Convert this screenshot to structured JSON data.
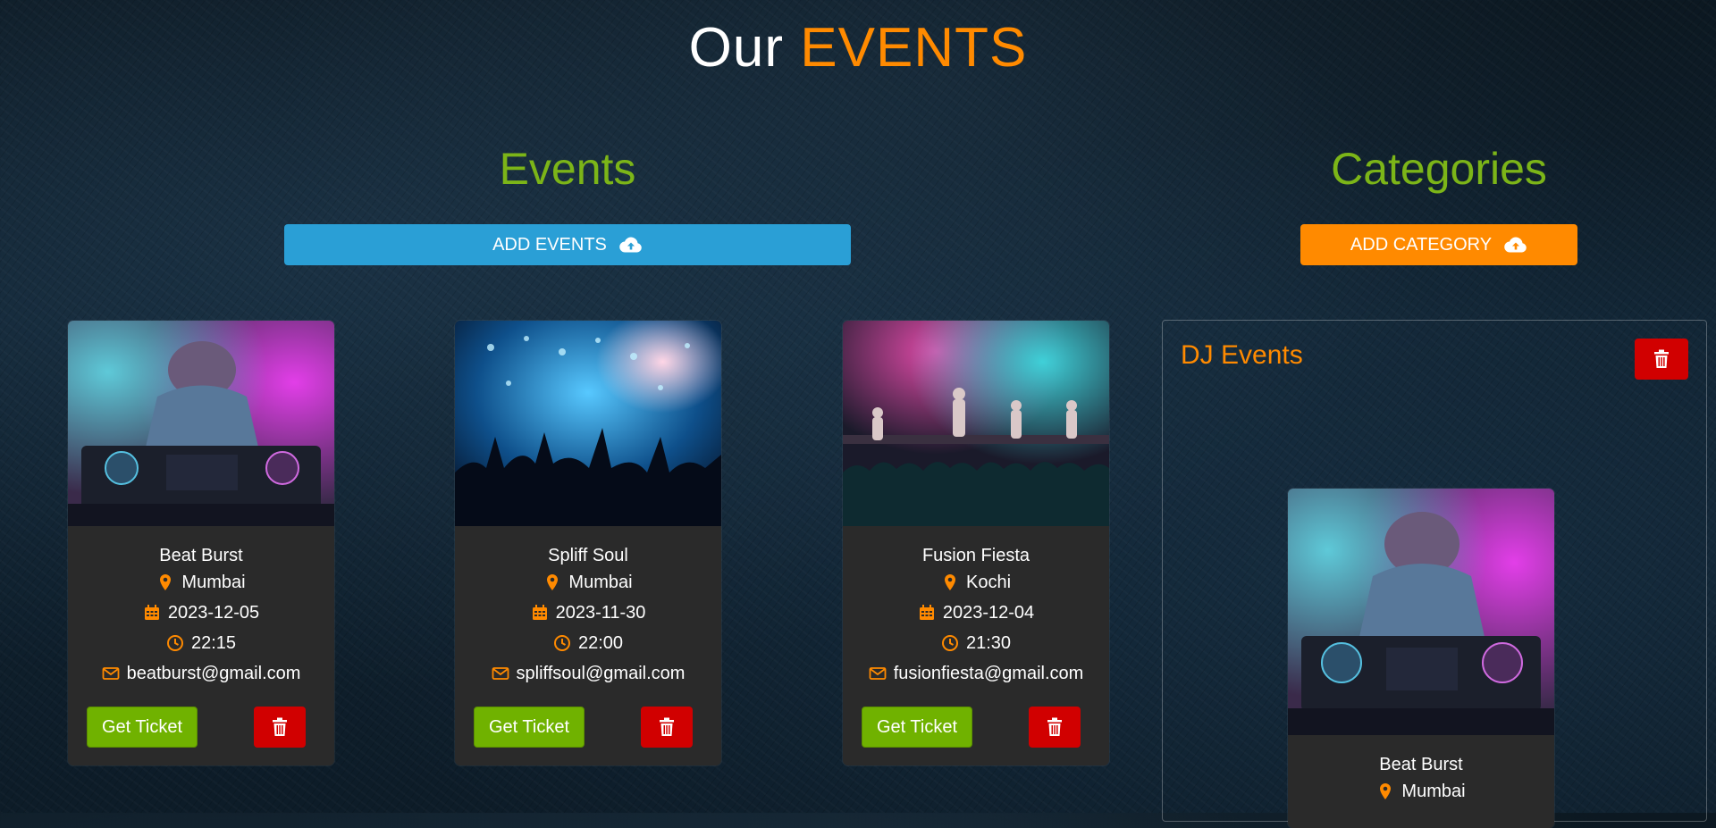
{
  "header": {
    "title_part1": "Our",
    "title_part2": "EVENTS"
  },
  "events_section": {
    "title": "Events",
    "add_button_label": "ADD EVENTS"
  },
  "categories_section": {
    "title": "Categories",
    "add_button_label": "ADD CATEGORY"
  },
  "events": [
    {
      "name": "Beat Burst",
      "location": "Mumbai",
      "date": "2023-12-05",
      "time": "22:15",
      "email": "beatburst@gmail.com",
      "ticket_label": "Get Ticket",
      "image": "dj-mixer-photo"
    },
    {
      "name": "Spliff Soul",
      "location": "Mumbai",
      "date": "2023-11-30",
      "time": "22:00",
      "email": "spliffsoul@gmail.com",
      "ticket_label": "Get Ticket",
      "image": "concert-crowd-photo"
    },
    {
      "name": "Fusion Fiesta",
      "location": "Kochi",
      "date": "2023-12-04",
      "time": "21:30",
      "email": "fusionfiesta@gmail.com",
      "ticket_label": "Get Ticket",
      "image": "live-band-photo"
    }
  ],
  "categories": [
    {
      "name": "DJ Events",
      "events": [
        {
          "name": "Beat Burst",
          "location": "Mumbai",
          "image": "dj-mixer-photo"
        }
      ]
    }
  ],
  "colors": {
    "accent_orange": "#ff8a00",
    "heading_green": "#7cb518",
    "add_events_blue": "#2a9fd6",
    "ticket_green": "#70b200",
    "delete_red": "#d10000",
    "card_bg": "#2a2a2a"
  },
  "icons": {
    "upload": "cloud-upload-icon",
    "location": "map-marker-icon",
    "date": "calendar-icon",
    "time": "clock-icon",
    "email": "envelope-icon",
    "delete": "trash-icon"
  }
}
